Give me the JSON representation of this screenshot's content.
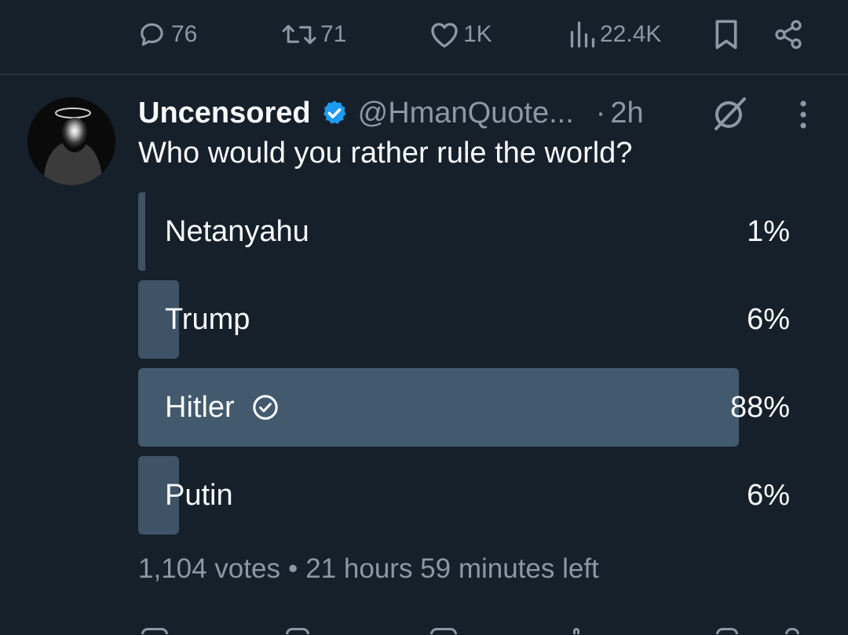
{
  "action_bar": {
    "replies": "76",
    "reposts": "71",
    "likes": "1K",
    "views": "22.4K"
  },
  "tweet": {
    "author_name": "Uncensored",
    "handle": "@HmanQuote...",
    "separator": "·",
    "time": "2h",
    "question": "Who would you rather rule the world?"
  },
  "poll": {
    "options": [
      {
        "label": "Netanyahu",
        "percent_text": "1%",
        "percent": 1
      },
      {
        "label": "Trump",
        "percent_text": "6%",
        "percent": 6
      },
      {
        "label": "Hitler",
        "percent_text": "88%",
        "percent": 88
      },
      {
        "label": "Putin",
        "percent_text": "6%",
        "percent": 6
      }
    ],
    "votes": "1,104 votes",
    "dot": "•",
    "time_left": "21 hours 59 minutes left"
  },
  "icons": {
    "reply": "reply-bubble-icon",
    "repost": "repost-arrows-icon",
    "like": "heart-icon",
    "views": "bar-chart-icon",
    "bookmark": "bookmark-icon",
    "share": "share-icon",
    "verified": "verified-badge-icon",
    "grok": "grok-slash-icon",
    "more": "vertical-ellipsis-icon",
    "winner": "check-circle-icon"
  },
  "colors": {
    "background": "#15202b",
    "text": "#f7f9f9",
    "muted": "#8b98a5",
    "poll_fill": "#3e5366",
    "verified": "#1d9bf0"
  }
}
